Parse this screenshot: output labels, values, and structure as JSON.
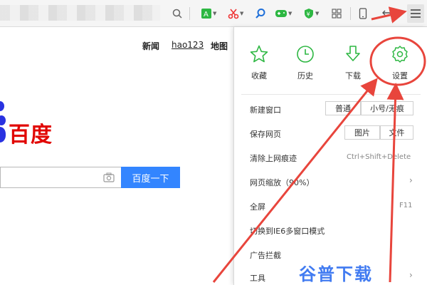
{
  "page": {
    "top_links": [
      "新闻",
      "hao123",
      "地图"
    ],
    "logo_text": "百度",
    "search_button": "百度一下"
  },
  "menu": {
    "quick_actions": [
      {
        "label": "收藏",
        "icon": "star-icon"
      },
      {
        "label": "历史",
        "icon": "clock-icon"
      },
      {
        "label": "下载",
        "icon": "download-icon"
      },
      {
        "label": "设置",
        "icon": "gear-icon"
      }
    ],
    "items": {
      "new_window": {
        "label": "新建窗口",
        "btn1": "普通",
        "btn2": "小号/无痕"
      },
      "save_page": {
        "label": "保存网页",
        "btn1": "图片",
        "btn2": "文件"
      },
      "clear_history": {
        "label": "清除上网痕迹",
        "shortcut": "Ctrl+Shift+Delete"
      },
      "zoom": {
        "label": "网页缩放（90%）"
      },
      "fullscreen": {
        "label": "全屏",
        "shortcut": "F11"
      },
      "ie6_mode": {
        "label": "切换到IE6多窗口模式"
      },
      "ad_block": {
        "label": "广告拦截"
      },
      "tools": {
        "label": "工具"
      }
    }
  },
  "watermark": "谷普下载",
  "colors": {
    "accent_green": "#2db742",
    "annotation_red": "#e8453c",
    "baidu_blue": "#2932e1",
    "baidu_red": "#e10602",
    "search_blue": "#3385ff"
  }
}
